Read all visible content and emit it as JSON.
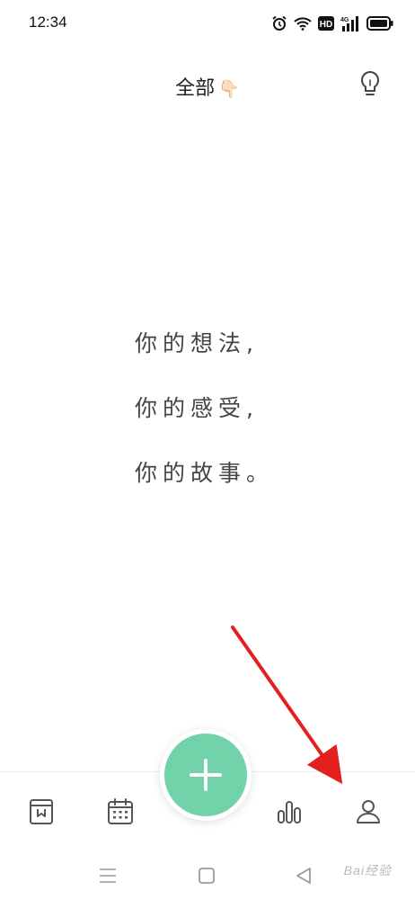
{
  "status_bar": {
    "time": "12:34",
    "icons": [
      "alarm-icon",
      "wifi-icon",
      "hd-icon",
      "signal-4g-icon",
      "battery-icon"
    ],
    "hd_label": "HD",
    "network_label": "4G"
  },
  "header": {
    "title": "全部",
    "title_emoji": "👇🏻"
  },
  "quote": {
    "line1": "你的想法,",
    "line2": "你的感受,",
    "line3": "你的故事。"
  },
  "bottom_nav": {
    "items": [
      "diary-book-icon",
      "calendar-icon",
      "add-button",
      "stats-chart-icon",
      "profile-icon"
    ]
  },
  "colors": {
    "fab": "#72d3aa",
    "arrow": "#e32020",
    "icon": "#555555"
  },
  "watermark": {
    "text": "Bai经验"
  }
}
